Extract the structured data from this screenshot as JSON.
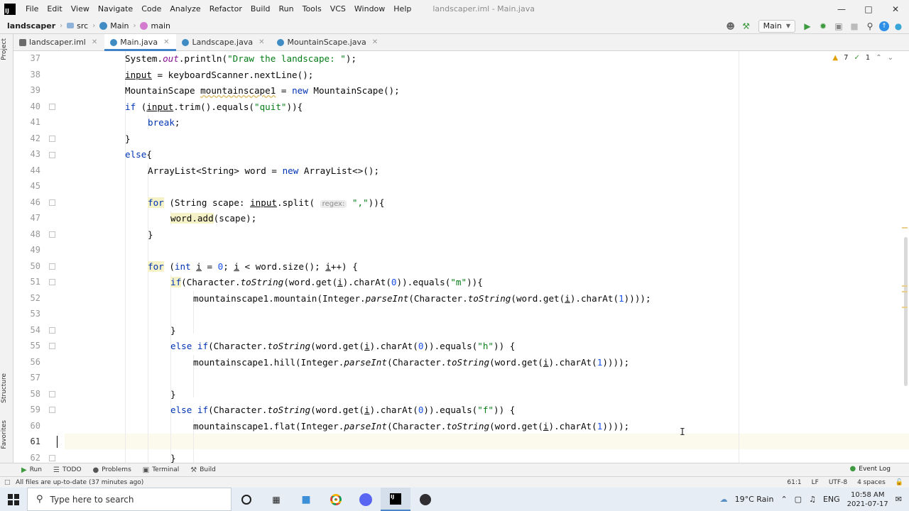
{
  "app": {
    "window_title": "landscaper.iml - Main.java",
    "menu": [
      "File",
      "Edit",
      "View",
      "Navigate",
      "Code",
      "Analyze",
      "Refactor",
      "Build",
      "Run",
      "Tools",
      "VCS",
      "Window",
      "Help"
    ],
    "logo_text": "IJ"
  },
  "navbar": {
    "breadcrumbs": [
      "landscaper",
      "src",
      "Main",
      "main"
    ],
    "run_config": "Main"
  },
  "left_strip": {
    "project": "Project",
    "structure": "Structure",
    "favorites": "Favorites"
  },
  "tabs": [
    {
      "label": "landscaper.iml",
      "active": false,
      "color": "#6b6b6b"
    },
    {
      "label": "Main.java",
      "active": true,
      "color": "#3f8cc4"
    },
    {
      "label": "Landscape.java",
      "active": false,
      "color": "#3f8cc4"
    },
    {
      "label": "MountainScape.java",
      "active": false,
      "color": "#3f8cc4"
    }
  ],
  "editor": {
    "warnings": "7",
    "weak_warnings": "1",
    "line_numbers": [
      "37",
      "38",
      "39",
      "40",
      "41",
      "42",
      "43",
      "44",
      "45",
      "46",
      "47",
      "48",
      "49",
      "50",
      "51",
      "52",
      "53",
      "54",
      "55",
      "56",
      "57",
      "58",
      "59",
      "60",
      "61",
      "62"
    ],
    "current_line": "61"
  },
  "bottom_tools": {
    "run": "Run",
    "todo": "TODO",
    "problems": "Problems",
    "terminal": "Terminal",
    "build": "Build",
    "event_log": "Event Log"
  },
  "status": {
    "message": "All files are up-to-date (37 minutes ago)",
    "position": "61:1",
    "line_sep": "LF",
    "encoding": "UTF-8",
    "indent": "4 spaces"
  },
  "taskbar": {
    "search_placeholder": "Type here to search",
    "weather": "19°C Rain",
    "lang": "ENG",
    "time": "10:58 AM",
    "date": "2021-07-17"
  },
  "colors": {
    "keyword": "#0033b3",
    "string": "#067d17",
    "number": "#1750eb",
    "accent": "#4083c9"
  }
}
